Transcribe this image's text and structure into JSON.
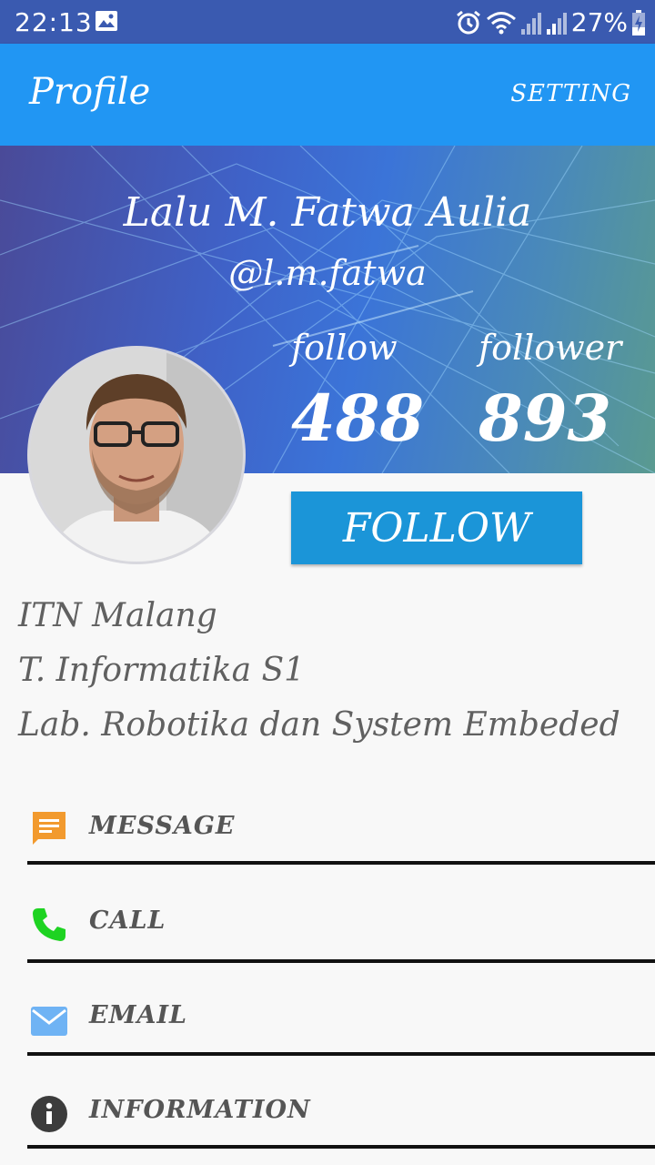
{
  "status_bar": {
    "time": "22:13",
    "battery": "27%"
  },
  "app_bar": {
    "title": "Profile",
    "setting_label": "SETTING"
  },
  "profile": {
    "name": "Lalu M. Fatwa Aulia",
    "handle": "@l.m.fatwa",
    "follow_label": "follow",
    "follow_count": "488",
    "follower_label": "follower",
    "follower_count": "893",
    "follow_button": "FOLLOW"
  },
  "info": [
    "ITN Malang",
    "T. Informatika S1",
    "Lab. Robotika dan System Embeded"
  ],
  "menu": [
    {
      "label": "MESSAGE",
      "icon": "message-icon",
      "color": "#f29a2e"
    },
    {
      "label": "CALL",
      "icon": "phone-icon",
      "color": "#1ed322"
    },
    {
      "label": "EMAIL",
      "icon": "email-icon",
      "color": "#6fb3f4"
    },
    {
      "label": "INFORMATION",
      "icon": "info-icon",
      "color": "#3c3c3c"
    }
  ],
  "colors": {
    "status_bar": "#3a5ab0",
    "app_bar": "#2196f3",
    "follow_button": "#1b95d8"
  }
}
